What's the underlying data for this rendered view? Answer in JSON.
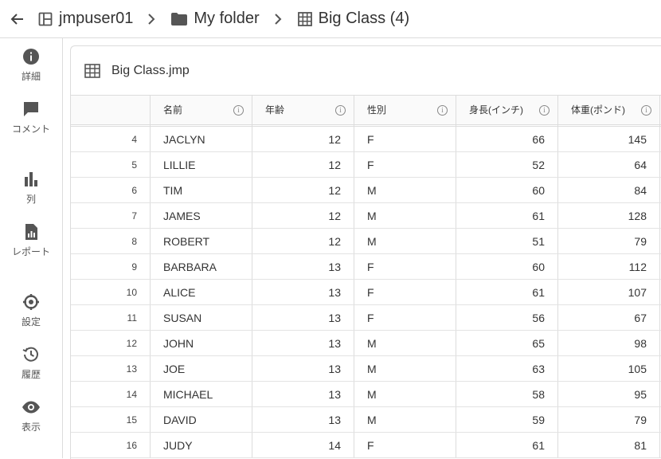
{
  "breadcrumb": {
    "user": "jmpuser01",
    "folder": "My folder",
    "table": "Big Class (4)"
  },
  "sidebar": {
    "items": [
      {
        "label": "詳細",
        "icon": "info-icon"
      },
      {
        "label": "コメント",
        "icon": "comment-icon"
      },
      {
        "label": "列",
        "icon": "columns-icon"
      },
      {
        "label": "レポート",
        "icon": "report-icon"
      },
      {
        "label": "設定",
        "icon": "settings-icon"
      },
      {
        "label": "履歴",
        "icon": "history-icon"
      },
      {
        "label": "表示",
        "icon": "eye-icon"
      }
    ]
  },
  "panel": {
    "title": "Big Class.jmp"
  },
  "table": {
    "columns": [
      "名前",
      "年齢",
      "性別",
      "身長(インチ)",
      "体重(ポンド)"
    ],
    "rows": [
      {
        "n": "4",
        "name": "JACLYN",
        "age": "12",
        "sex": "F",
        "height": "66",
        "weight": "145"
      },
      {
        "n": "5",
        "name": "LILLIE",
        "age": "12",
        "sex": "F",
        "height": "52",
        "weight": "64"
      },
      {
        "n": "6",
        "name": "TIM",
        "age": "12",
        "sex": "M",
        "height": "60",
        "weight": "84"
      },
      {
        "n": "7",
        "name": "JAMES",
        "age": "12",
        "sex": "M",
        "height": "61",
        "weight": "128"
      },
      {
        "n": "8",
        "name": "ROBERT",
        "age": "12",
        "sex": "M",
        "height": "51",
        "weight": "79"
      },
      {
        "n": "9",
        "name": "BARBARA",
        "age": "13",
        "sex": "F",
        "height": "60",
        "weight": "112"
      },
      {
        "n": "10",
        "name": "ALICE",
        "age": "13",
        "sex": "F",
        "height": "61",
        "weight": "107"
      },
      {
        "n": "11",
        "name": "SUSAN",
        "age": "13",
        "sex": "F",
        "height": "56",
        "weight": "67"
      },
      {
        "n": "12",
        "name": "JOHN",
        "age": "13",
        "sex": "M",
        "height": "65",
        "weight": "98"
      },
      {
        "n": "13",
        "name": "JOE",
        "age": "13",
        "sex": "M",
        "height": "63",
        "weight": "105"
      },
      {
        "n": "14",
        "name": "MICHAEL",
        "age": "13",
        "sex": "M",
        "height": "58",
        "weight": "95"
      },
      {
        "n": "15",
        "name": "DAVID",
        "age": "13",
        "sex": "M",
        "height": "59",
        "weight": "79"
      },
      {
        "n": "16",
        "name": "JUDY",
        "age": "14",
        "sex": "F",
        "height": "61",
        "weight": "81"
      }
    ]
  },
  "colors": {
    "icon": "#555555",
    "border": "#dcdcdc"
  }
}
